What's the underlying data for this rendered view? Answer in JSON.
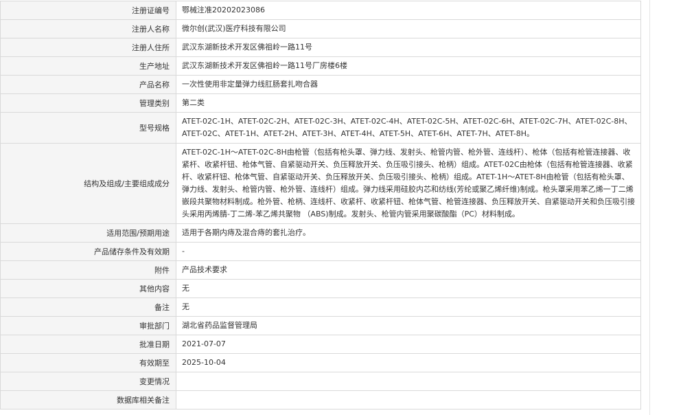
{
  "rows": [
    {
      "label": "注册证编号",
      "value": "鄂械注准20202023086"
    },
    {
      "label": "注册人名称",
      "value": "微尔创(武汉)医疗科技有限公司"
    },
    {
      "label": "注册人住所",
      "value": "武汉东湖新技术开发区佛祖岭一路11号"
    },
    {
      "label": "生产地址",
      "value": "武汉东湖新技术开发区佛祖岭一路11号厂房楼6楼"
    },
    {
      "label": "产品名称",
      "value": "一次性使用非定量弹力线肛肠套扎吻合器"
    },
    {
      "label": "管理类别",
      "value": "第二类"
    },
    {
      "label": "型号规格",
      "value": "ATET-02C-1H、ATET-02C-2H、ATET-02C-3H、ATET-02C-4H、ATET-02C-5H、ATET-02C-6H、ATET-02C-7H、ATET-02C-8H、ATET-02C、ATET-1H、ATET-2H、ATET-3H、ATET-4H、ATET-5H、ATET-6H、ATET-7H、ATET-8H。"
    },
    {
      "label": "结构及组成/主要组成成分",
      "value": "ATET-02C-1H～ATET-02C-8H由枪管（包括有枪头罩、弹力线、发射头、枪管内管、枪外管、连线杆）、枪体（包括有枪管连接器、收紧杆、收紧杆钮、枪体气管、自紧驱动开关、负压释放开关、负压吸引接头、枪柄）组成。ATET-02C由枪体（包括有枪管连接器、收紧杆、收紧杆钮、枪体气管、自紧驱动开关、负压释放开关、负压吸引接头、枪柄）组成。ATET-1H～ATET-8H由枪管（包括有枪头罩、弹力线、发射头、枪管内管、枪外管、连线杆）组成。弹力线采用硅胶内芯和纺线(芳纶或聚乙烯纤维)制成。枪头罩采用苯乙烯一丁二烯嵌段共聚物材料制成。枪外管、枪柄、连线杆、收紧杆、收紧杆钮、枪体气管、枪管连接器、负压释放开关、自紧驱动开关和负压吸引接头采用丙烯腈-丁二烯-苯乙烯共聚物 （ABS)制成。发射头、枪管内管采用聚碳酸酯（PC）材料制成。"
    },
    {
      "label": "适用范围/预期用途",
      "value": "适用于各期内痔及混合痔的套扎治疗。"
    },
    {
      "label": "产品储存条件及有效期",
      "value": "-"
    },
    {
      "label": "附件",
      "value": "产品技术要求"
    },
    {
      "label": "其他内容",
      "value": "无"
    },
    {
      "label": "备注",
      "value": "无"
    },
    {
      "label": "审批部门",
      "value": "湖北省药品监督管理局"
    },
    {
      "label": "批准日期",
      "value": "2021-07-07"
    },
    {
      "label": "有效期至",
      "value": "2025-10-04"
    },
    {
      "label": "变更情况",
      "value": ""
    },
    {
      "label": "数据库相关备注",
      "value": ""
    }
  ]
}
